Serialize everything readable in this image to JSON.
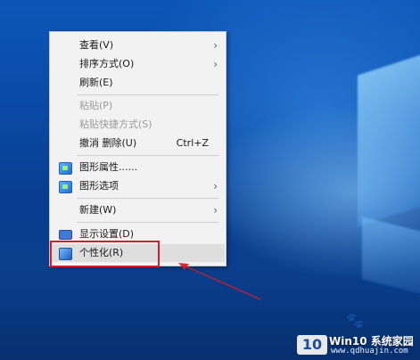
{
  "context_menu": {
    "items": [
      {
        "label": "查看(V)",
        "submenu": true,
        "disabled": false
      },
      {
        "label": "排序方式(O)",
        "submenu": true,
        "disabled": false
      },
      {
        "label": "刷新(E)",
        "submenu": false,
        "disabled": false
      },
      {
        "label": "粘贴(P)",
        "submenu": false,
        "disabled": true
      },
      {
        "label": "粘贴快捷方式(S)",
        "submenu": false,
        "disabled": true
      },
      {
        "label": "撤消 删除(U)",
        "shortcut": "Ctrl+Z",
        "disabled": false
      },
      {
        "label": "图形属性......",
        "icon": "graphics-icon",
        "disabled": false
      },
      {
        "label": "图形选项",
        "icon": "graphics-icon",
        "submenu": true,
        "disabled": false
      },
      {
        "label": "新建(W)",
        "submenu": true,
        "disabled": false
      },
      {
        "label": "显示设置(D)",
        "icon": "display-icon",
        "disabled": false
      },
      {
        "label": "个性化(R)",
        "icon": "personalize-icon",
        "disabled": false,
        "highlighted": true
      }
    ],
    "chevron_glyph": "›"
  },
  "watermark": {
    "badge": "10",
    "title": "Win10 系统家园",
    "url": "www.qdhuajin.com"
  },
  "colors": {
    "annotation_red": "#d41d2a",
    "menu_background": "#f2f2f2",
    "desktop_blue": "#0a4aa6"
  }
}
